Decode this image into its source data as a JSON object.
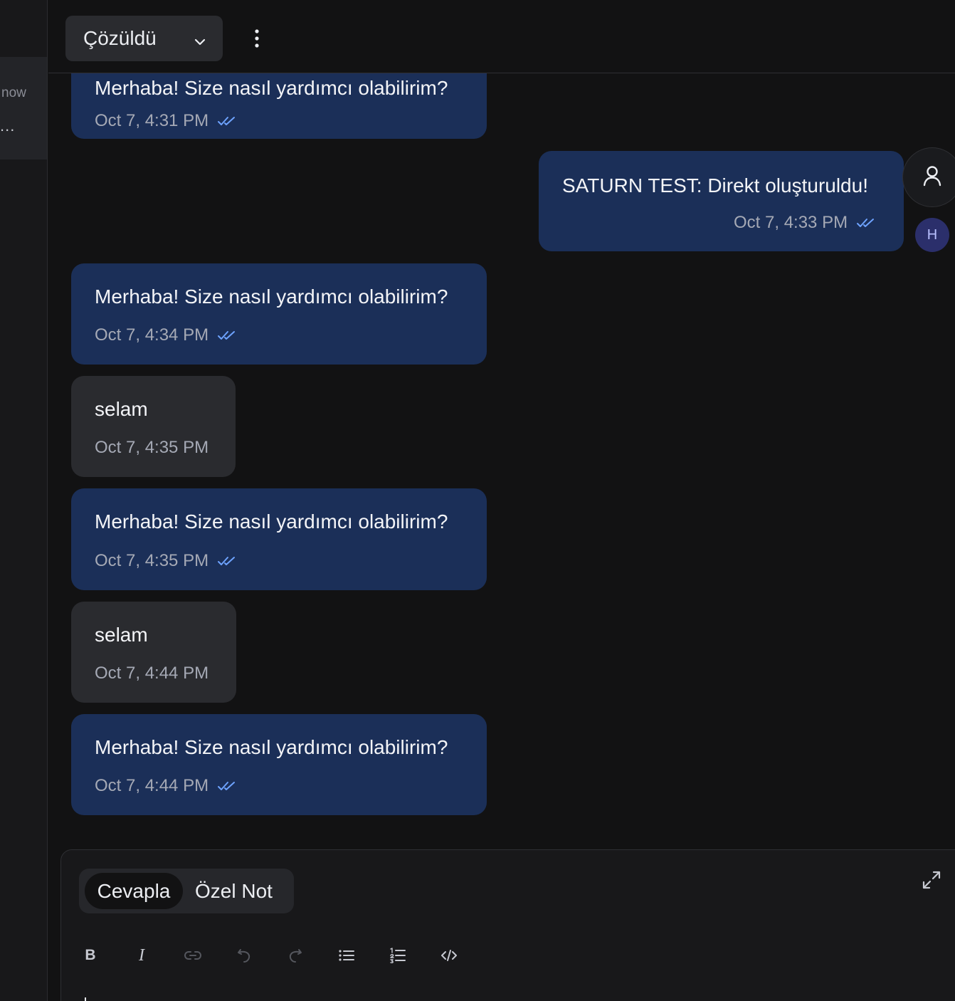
{
  "sidebar": {
    "time": "now",
    "ellipsis": "..."
  },
  "header": {
    "status": "Çözüldü",
    "icons": [
      "chevron-down-icon",
      "more-vertical-icon"
    ]
  },
  "messages": [
    {
      "direction": "out",
      "text": "Merhaba! Size nasıl yardımcı olabilirim?",
      "time": "Oct 7, 4:31 PM",
      "read": true
    },
    {
      "direction": "out-agent",
      "text": "SATURN TEST: Direkt oluşturuldu!",
      "time": "Oct 7, 4:33 PM",
      "read": true
    },
    {
      "direction": "out",
      "text": "Merhaba! Size nasıl yardımcı olabilirim?",
      "time": "Oct 7, 4:34 PM",
      "read": true
    },
    {
      "direction": "in",
      "text": "selam",
      "time": "Oct 7, 4:35 PM",
      "read": false
    },
    {
      "direction": "out",
      "text": "Merhaba! Size nasıl yardımcı olabilirim?",
      "time": "Oct 7, 4:35 PM",
      "read": true
    },
    {
      "direction": "in",
      "text": "selam",
      "time": "Oct 7, 4:44 PM",
      "read": false
    },
    {
      "direction": "out",
      "text": "Merhaba! Size nasıl yardımcı olabilirim?",
      "time": "Oct 7, 4:44 PM",
      "read": true
    }
  ],
  "avatars": {
    "agent_icon": "user-icon",
    "user_initial": "H"
  },
  "composer": {
    "tabs": [
      {
        "label": "Cevapla",
        "active": true
      },
      {
        "label": "Özel Not",
        "active": false
      }
    ],
    "toolbar": [
      {
        "name": "bold-icon",
        "glyph": "B",
        "enabled": true
      },
      {
        "name": "italic-icon",
        "glyph": "I",
        "enabled": true
      },
      {
        "name": "link-icon",
        "glyph": "",
        "enabled": false
      },
      {
        "name": "undo-icon",
        "glyph": "",
        "enabled": false
      },
      {
        "name": "redo-icon",
        "glyph": "",
        "enabled": false
      },
      {
        "name": "bullet-list-icon",
        "glyph": "",
        "enabled": true
      },
      {
        "name": "numbered-list-icon",
        "glyph": "",
        "enabled": true
      },
      {
        "name": "code-icon",
        "glyph": "",
        "enabled": true
      }
    ]
  },
  "colors": {
    "background": "#121213",
    "outgoing_bubble": "#1b2f58",
    "incoming_bubble": "#2a2b2f",
    "read_tick": "#6ea3ff"
  }
}
